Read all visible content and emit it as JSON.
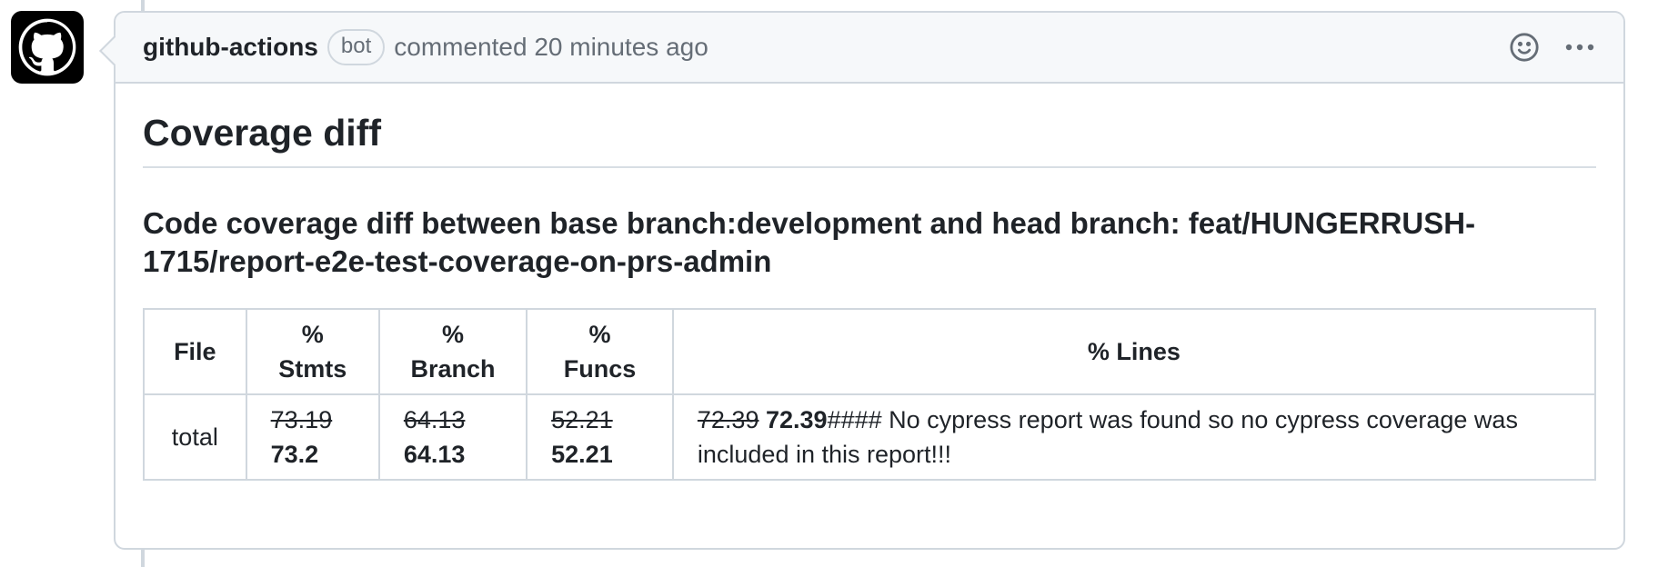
{
  "comment": {
    "author": "github-actions",
    "badge": "bot",
    "meta": "commented 20 minutes ago",
    "actions": {
      "reaction_icon": "smiley-icon",
      "menu_icon": "kebab-horizontal-icon"
    },
    "title": "Coverage diff",
    "subtitle": "Code coverage diff between base branch:development and head branch: feat/HUNGERRUSH-1715/report-e2e-test-coverage-on-prs-admin",
    "table": {
      "headers": {
        "file": "File",
        "stmts_pct": "%",
        "stmts": "Stmts",
        "branch_pct": "%",
        "branch": "Branch",
        "funcs_pct": "%",
        "funcs": "Funcs",
        "lines": "% Lines"
      },
      "row": {
        "file": "total",
        "stmts_old": "73.19",
        "stmts_new": "73.2",
        "branch_old": "64.13",
        "branch_new": "64.13",
        "funcs_old": "52.21",
        "funcs_new": "52.21",
        "lines_old": "72.39",
        "lines_new": "72.39",
        "lines_note": "#### No cypress report was found so no cypress coverage was included in this report!!!"
      }
    }
  },
  "colors": {
    "border": "#d0d7de",
    "header_bg": "#f6f8fa",
    "muted_text": "#656d76",
    "text": "#1f2328"
  }
}
